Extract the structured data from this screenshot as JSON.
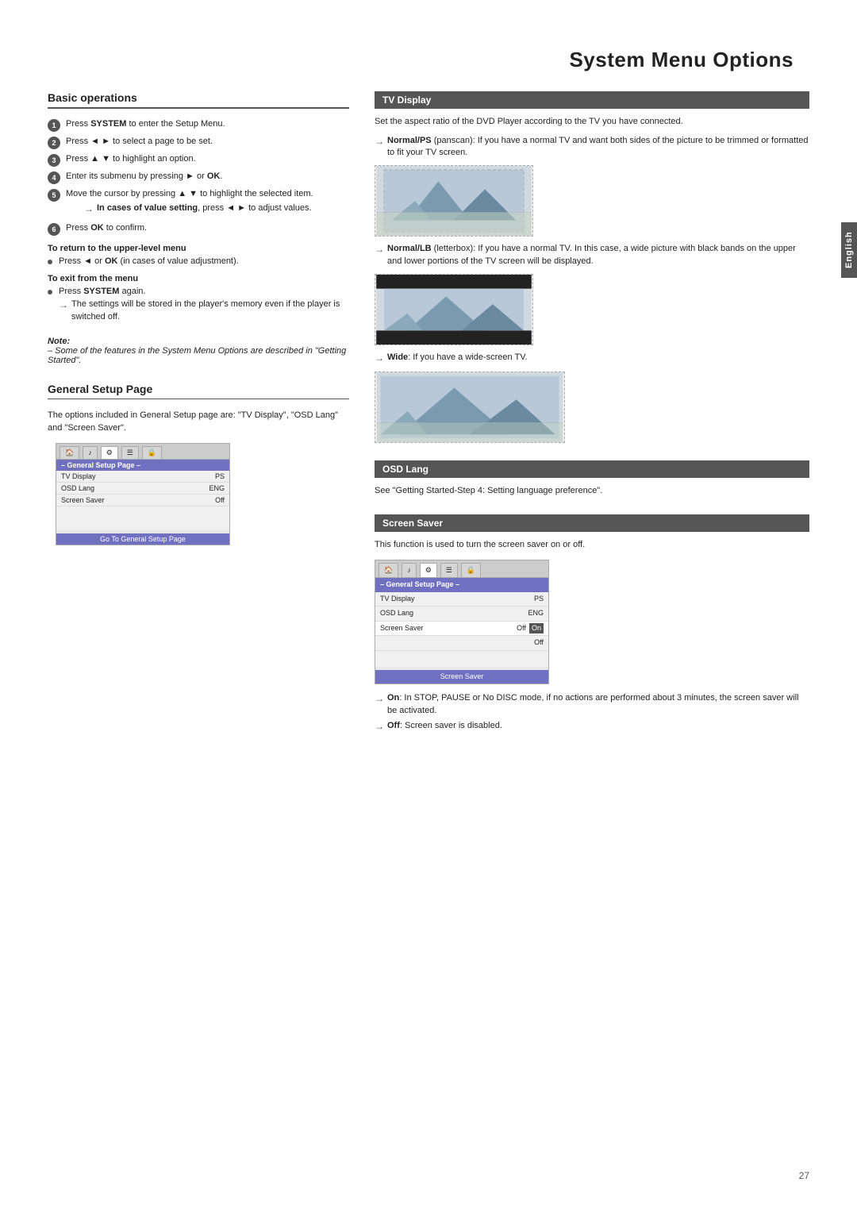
{
  "page": {
    "title": "System Menu Options",
    "page_number": "27",
    "english_tab": "English"
  },
  "basic_operations": {
    "section_title": "Basic operations",
    "steps": [
      {
        "num": "1",
        "text_before": "Press ",
        "bold": "SYSTEM",
        "text_after": " to enter the Setup Menu."
      },
      {
        "num": "2",
        "text_before": "Press ◄ ► to select a page to be set."
      },
      {
        "num": "3",
        "text_before": "Press ▲ ▼ to highlight an option."
      },
      {
        "num": "4",
        "text_before": "Enter its submenu by pressing ► or ",
        "bold2": "OK",
        "text_after": "."
      },
      {
        "num": "5",
        "text_before": "Move the cursor by pressing ▲ ▼ to highlight the selected item."
      }
    ],
    "arrow_note": "In cases of value setting, press ◄ ► to adjust values.",
    "step6_before": "Press ",
    "step6_bold": "OK",
    "step6_after": " to confirm.",
    "return_heading": "To return to the upper-level menu",
    "return_text_before": "Press ◄ or ",
    "return_bold": "OK",
    "return_text_after": " (in cases of value adjustment).",
    "exit_heading": "To exit from the menu",
    "exit_before": "Press ",
    "exit_bold": "SYSTEM",
    "exit_after": " again.",
    "exit_arrow": "The settings will be stored in the player's memory even if the player is switched off.",
    "note_label": "Note:",
    "note_italic": "– Some of the features in the System Menu Options are described in \"Getting Started\"."
  },
  "general_setup": {
    "section_title": "General Setup Page",
    "description": "The options included in General Setup page are: \"TV Display\", \"OSD Lang\" and \"Screen Saver\".",
    "mini_ui": {
      "label": "– General Setup Page –",
      "rows": [
        {
          "label": "TV Display",
          "value": "PS"
        },
        {
          "label": "OSD Lang",
          "value": "ENG"
        },
        {
          "label": "Screen Saver",
          "value": "Off"
        }
      ],
      "footer": "Go To General Setup Page"
    }
  },
  "tv_display": {
    "section_title": "TV Display",
    "description": "Set the aspect ratio of the DVD Player according to the TV you have connected.",
    "normal_ps": {
      "arrow": "→",
      "bold": "Normal/PS",
      "text": " (panscan): If you have a normal TV and want both sides of the picture to be trimmed or formatted to fit your TV screen."
    },
    "normal_lb": {
      "arrow": "→",
      "bold": "Normal/LB",
      "text": " (letterbox): If you have a normal TV. In this case, a wide picture with black bands on the upper and lower portions of the TV screen will be displayed."
    },
    "wide": {
      "arrow": "→",
      "bold": "Wide",
      "text": ": If you have a wide-screen TV."
    }
  },
  "osd_lang": {
    "section_title": "OSD Lang",
    "description": "See \"Getting Started-Step 4: Setting language preference\"."
  },
  "screen_saver": {
    "section_title": "Screen Saver",
    "description": "This function is used to turn the screen saver on or off.",
    "mini_ui": {
      "label": "– General Setup Page –",
      "rows": [
        {
          "label": "TV Display",
          "value": "PS"
        },
        {
          "label": "OSD Lang",
          "value": "ENG"
        },
        {
          "label": "Screen Saver",
          "value": "Off",
          "extra": "On"
        },
        {
          "label": "",
          "value": "Off"
        }
      ],
      "footer": "Screen Saver"
    },
    "on_arrow": "→",
    "on_bold": "On",
    "on_text": ": In STOP, PAUSE or No DISC mode, if no actions are performed about 3 minutes, the screen saver will be activated.",
    "off_arrow": "→",
    "off_bold": "Off",
    "off_text": ": Screen saver is disabled."
  }
}
